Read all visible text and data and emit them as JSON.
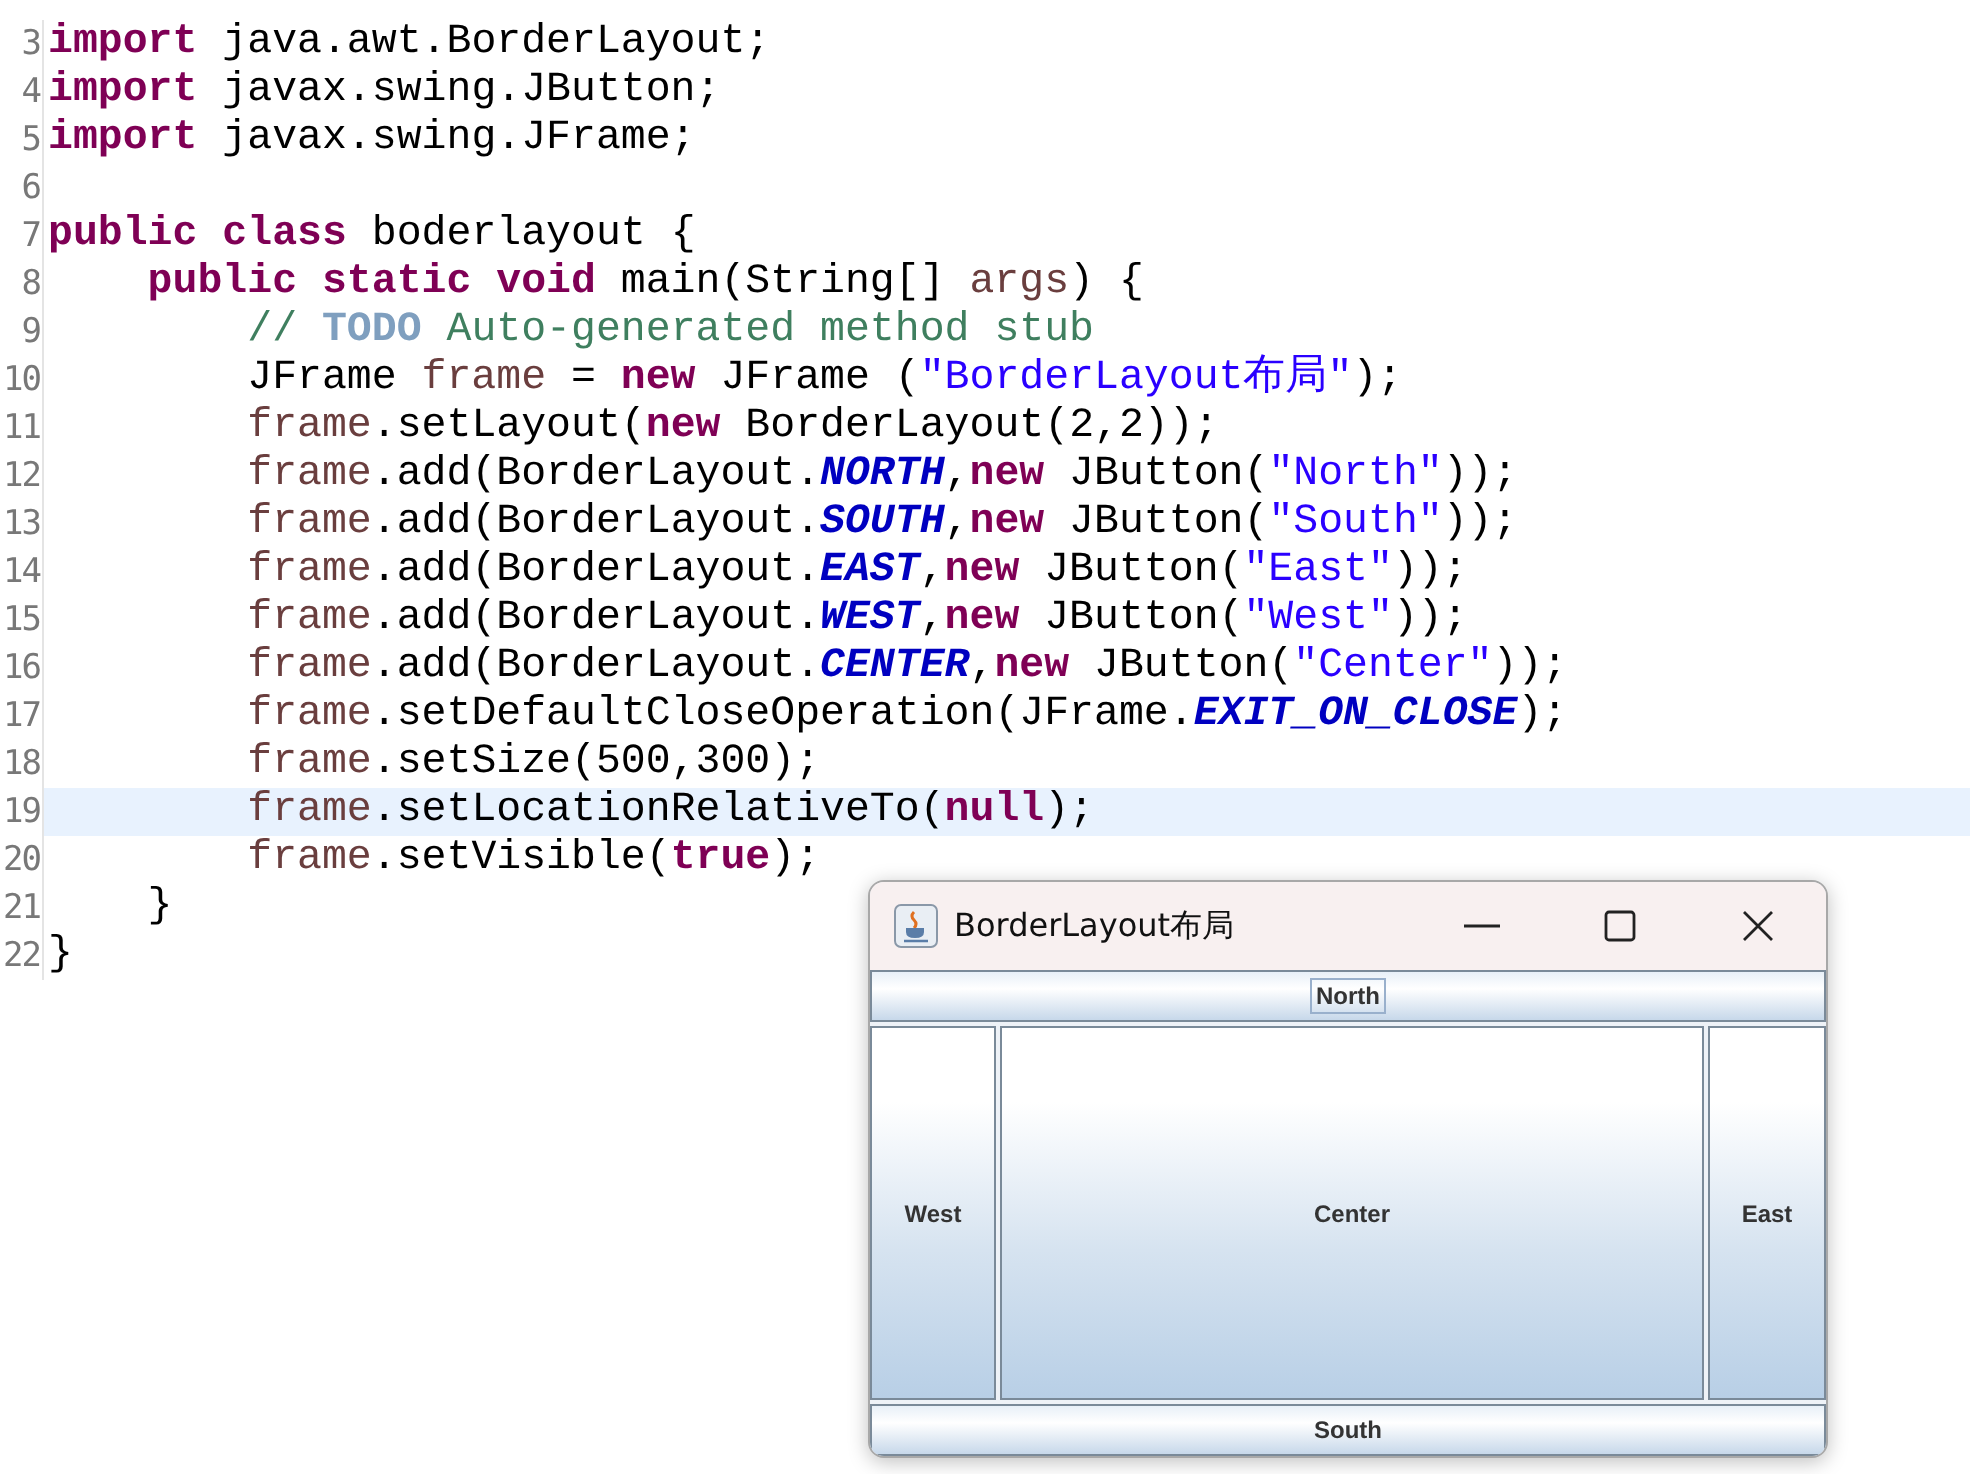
{
  "editor": {
    "lines": [
      {
        "number": "3",
        "current": false,
        "tokens": [
          {
            "kind": "keyword",
            "text": "import"
          },
          {
            "kind": "plain",
            "text": " java.awt.BorderLayout;"
          }
        ]
      },
      {
        "number": "4",
        "current": false,
        "tokens": [
          {
            "kind": "keyword",
            "text": "import"
          },
          {
            "kind": "plain",
            "text": " javax.swing.JButton;"
          }
        ]
      },
      {
        "number": "5",
        "current": false,
        "tokens": [
          {
            "kind": "keyword",
            "text": "import"
          },
          {
            "kind": "plain",
            "text": " javax.swing.JFrame;"
          }
        ]
      },
      {
        "number": "6",
        "current": false
      },
      {
        "number": "7",
        "current": false,
        "tokens": [
          {
            "kind": "keyword",
            "text": "public class"
          },
          {
            "kind": "plain",
            "text": " boderlayout {"
          }
        ]
      },
      {
        "number": "8",
        "current": false,
        "tokens": [
          {
            "kind": "keyword",
            "text": "    public static void"
          },
          {
            "kind": "plain",
            "text": " main(String[] "
          },
          {
            "kind": "variable",
            "text": "args"
          },
          {
            "kind": "plain",
            "text": ") {"
          }
        ]
      },
      {
        "number": "9",
        "current": false,
        "tokens": [
          {
            "kind": "comment",
            "text": "        // "
          },
          {
            "kind": "todo",
            "text": "TODO"
          },
          {
            "kind": "comment",
            "text": " Auto-generated method stub"
          }
        ]
      },
      {
        "number": "10",
        "current": false,
        "tokens": [
          {
            "kind": "plain",
            "text": "        JFrame "
          },
          {
            "kind": "variable",
            "text": "frame"
          },
          {
            "kind": "plain",
            "text": " = "
          },
          {
            "kind": "keyword",
            "text": "new"
          },
          {
            "kind": "plain",
            "text": " JFrame ("
          },
          {
            "kind": "string",
            "text": "\"BorderLayout布局\""
          },
          {
            "kind": "plain",
            "text": ");"
          }
        ]
      },
      {
        "number": "11",
        "current": false,
        "tokens": [
          {
            "kind": "variable",
            "text": "        frame"
          },
          {
            "kind": "plain",
            "text": ".setLayout("
          },
          {
            "kind": "keyword",
            "text": "new"
          },
          {
            "kind": "plain",
            "text": " BorderLayout(2,2));"
          }
        ]
      },
      {
        "number": "12",
        "current": false,
        "tokens": [
          {
            "kind": "variable",
            "text": "        frame"
          },
          {
            "kind": "plain",
            "text": ".add(BorderLayout."
          },
          {
            "kind": "constant",
            "text": "NORTH"
          },
          {
            "kind": "plain",
            "text": ","
          },
          {
            "kind": "keyword",
            "text": "new"
          },
          {
            "kind": "plain",
            "text": " JButton("
          },
          {
            "kind": "string",
            "text": "\"North\""
          },
          {
            "kind": "plain",
            "text": "));"
          }
        ]
      },
      {
        "number": "13",
        "current": false,
        "tokens": [
          {
            "kind": "variable",
            "text": "        frame"
          },
          {
            "kind": "plain",
            "text": ".add(BorderLayout."
          },
          {
            "kind": "constant",
            "text": "SOUTH"
          },
          {
            "kind": "plain",
            "text": ","
          },
          {
            "kind": "keyword",
            "text": "new"
          },
          {
            "kind": "plain",
            "text": " JButton("
          },
          {
            "kind": "string",
            "text": "\"South\""
          },
          {
            "kind": "plain",
            "text": "));"
          }
        ]
      },
      {
        "number": "14",
        "current": false,
        "tokens": [
          {
            "kind": "variable",
            "text": "        frame"
          },
          {
            "kind": "plain",
            "text": ".add(BorderLayout."
          },
          {
            "kind": "constant",
            "text": "EAST"
          },
          {
            "kind": "plain",
            "text": ","
          },
          {
            "kind": "keyword",
            "text": "new"
          },
          {
            "kind": "plain",
            "text": " JButton("
          },
          {
            "kind": "string",
            "text": "\"East\""
          },
          {
            "kind": "plain",
            "text": "));"
          }
        ]
      },
      {
        "number": "15",
        "current": false,
        "tokens": [
          {
            "kind": "variable",
            "text": "        frame"
          },
          {
            "kind": "plain",
            "text": ".add(BorderLayout."
          },
          {
            "kind": "constant",
            "text": "WEST"
          },
          {
            "kind": "plain",
            "text": ","
          },
          {
            "kind": "keyword",
            "text": "new"
          },
          {
            "kind": "plain",
            "text": " JButton("
          },
          {
            "kind": "string",
            "text": "\"West\""
          },
          {
            "kind": "plain",
            "text": "));"
          }
        ]
      },
      {
        "number": "16",
        "current": false,
        "tokens": [
          {
            "kind": "variable",
            "text": "        frame"
          },
          {
            "kind": "plain",
            "text": ".add(BorderLayout."
          },
          {
            "kind": "constant",
            "text": "CENTER"
          },
          {
            "kind": "plain",
            "text": ","
          },
          {
            "kind": "keyword",
            "text": "new"
          },
          {
            "kind": "plain",
            "text": " JButton("
          },
          {
            "kind": "string",
            "text": "\"Center\""
          },
          {
            "kind": "plain",
            "text": "));"
          }
        ]
      },
      {
        "number": "17",
        "current": false,
        "tokens": [
          {
            "kind": "variable",
            "text": "        frame"
          },
          {
            "kind": "plain",
            "text": ".setDefaultCloseOperation(JFrame."
          },
          {
            "kind": "constant",
            "text": "EXIT_ON_CLOSE"
          },
          {
            "kind": "plain",
            "text": ");"
          }
        ]
      },
      {
        "number": "18",
        "current": false,
        "tokens": [
          {
            "kind": "variable",
            "text": "        frame"
          },
          {
            "kind": "plain",
            "text": ".setSize(500,300);"
          }
        ]
      },
      {
        "number": "19",
        "current": true,
        "tokens": [
          {
            "kind": "variable",
            "text": "        frame"
          },
          {
            "kind": "plain",
            "text": ".setLocationRelativeTo("
          },
          {
            "kind": "keyword",
            "text": "null"
          },
          {
            "kind": "plain",
            "text": ");"
          }
        ]
      },
      {
        "number": "20",
        "current": false,
        "tokens": [
          {
            "kind": "variable",
            "text": "        frame"
          },
          {
            "kind": "plain",
            "text": ".setVisible("
          },
          {
            "kind": "keyword",
            "text": "true"
          },
          {
            "kind": "plain",
            "text": ");"
          }
        ]
      },
      {
        "number": "21",
        "current": false,
        "tokens": [
          {
            "kind": "plain",
            "text": "    }"
          }
        ]
      },
      {
        "number": "22",
        "current": false,
        "tokens": [
          {
            "kind": "plain",
            "text": "}"
          }
        ]
      }
    ]
  },
  "window": {
    "title": "BorderLayout布局",
    "buttons": [
      {
        "kind": "north",
        "label": "North",
        "focused": true
      },
      {
        "kind": "west",
        "label": "West",
        "focused": false
      },
      {
        "kind": "center",
        "label": "Center",
        "focused": false
      },
      {
        "kind": "east",
        "label": "East",
        "focused": false
      },
      {
        "kind": "south",
        "label": "South",
        "focused": false
      }
    ]
  }
}
